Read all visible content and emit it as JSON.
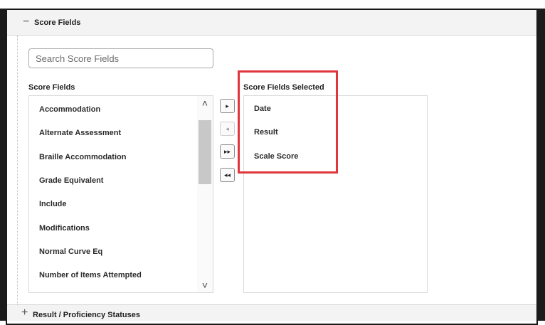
{
  "score_section": {
    "toggle_symbol": "−",
    "title": "Score Fields"
  },
  "search": {
    "placeholder": "Search Score Fields",
    "value": ""
  },
  "available": {
    "label": "Score Fields",
    "items": [
      "Accommodation",
      "Alternate Assessment",
      "Braille Accommodation",
      "Grade Equivalent",
      "Include",
      "Modifications",
      "Normal Curve Eq",
      "Number of Items Attempted"
    ]
  },
  "selected": {
    "label": "Score Fields Selected",
    "items": [
      "Date",
      "Result",
      "Scale Score"
    ]
  },
  "move_buttons": {
    "move_right": "▸",
    "move_left": "◂",
    "move_all_right": "▸▸",
    "move_all_left": "◂◂"
  },
  "scroll": {
    "up": "˄",
    "down": "˅"
  },
  "result_section": {
    "toggle_symbol": "+",
    "title": "Result / Proficiency Statuses"
  },
  "colors": {
    "highlight": "#e0353a",
    "header_bg": "#f3f3f3"
  }
}
